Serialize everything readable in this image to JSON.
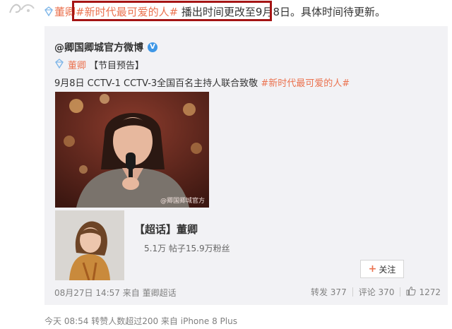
{
  "post": {
    "author_name": "董卿",
    "hashtag": "#新时代最可爱的人#",
    "text": " 播出时间更改至9月8日。具体时间待更新。"
  },
  "repost": {
    "author": "@卿国卿城官方微博",
    "tag_author": "董卿",
    "tag_label": "【节目预告】",
    "description_text": "9月8日 CCTV-1 CCTV-3全国百名主持人联合致敬",
    "description_hashtag": "#新时代最可爱的人#",
    "image_watermark": "@卿国卿城官方",
    "supertopic": {
      "title": "【超话】董卿",
      "stats": "5.1万 帖子15.9万粉丝",
      "follow_label": "关注"
    },
    "footer": {
      "time": "08月27日 14:57 来自 董卿超话",
      "repost_label": "转发",
      "repost_count": "377",
      "comment_label": "评论",
      "comment_count": "370",
      "like_count": "1272"
    }
  },
  "bottom": {
    "meta": "今天 08:54 转赞人数超过200  来自 iPhone 8 Plus"
  },
  "colors": {
    "link": "#eb7350",
    "highlight_box": "#a51515",
    "card_bg": "#f2f2f5",
    "verified": "#3f97e6"
  }
}
